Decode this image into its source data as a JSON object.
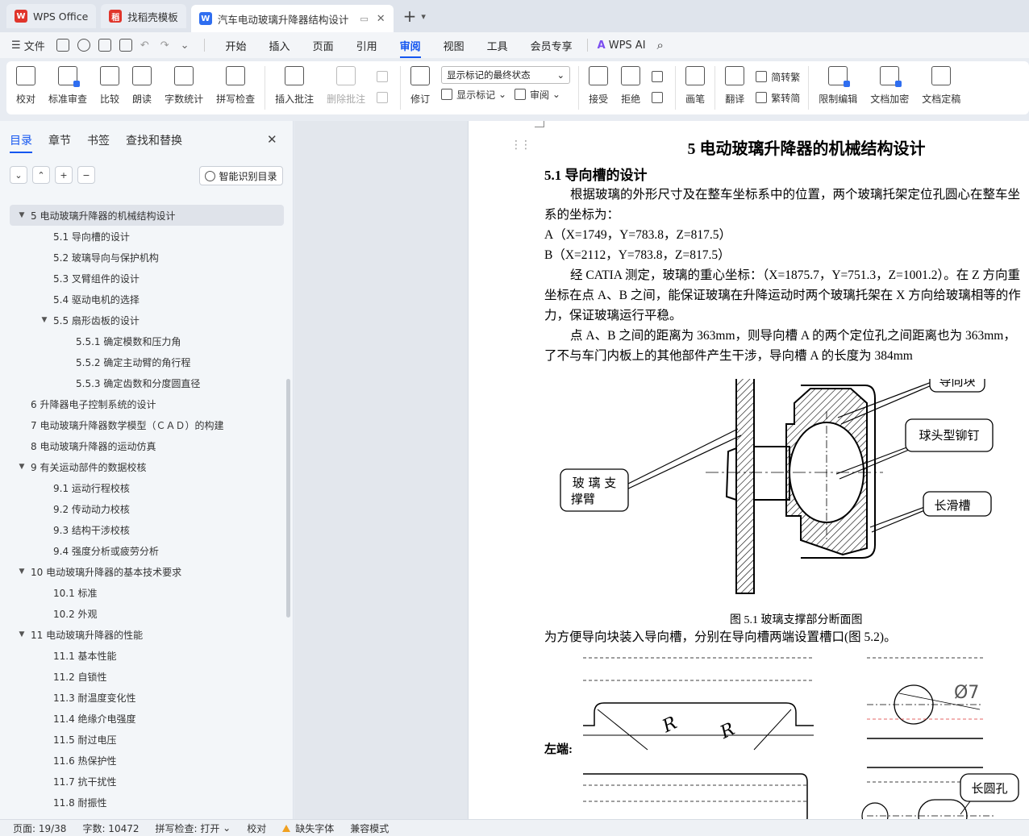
{
  "tabs": [
    {
      "label": "WPS Office",
      "color": "#e0352b"
    },
    {
      "label": "找稻壳模板",
      "color": "#e0352b"
    },
    {
      "label": "汽车电动玻璃升降器结构设计",
      "color": "#2f6ef0"
    }
  ],
  "menubar": {
    "file": "文件",
    "items": [
      "开始",
      "插入",
      "页面",
      "引用",
      "审阅",
      "视图",
      "工具",
      "会员专享"
    ],
    "active": "审阅",
    "wps_ai": "WPS AI"
  },
  "ribbon": {
    "proofread": "校对",
    "standard_review": "标准审查",
    "compare": "比较",
    "read_aloud": "朗读",
    "word_count": "字数统计",
    "spell_check": "拼写检查",
    "insert_comment": "插入批注",
    "delete_comment": "删除批注",
    "revise": "修订",
    "markup_display": "显示标记的最终状态",
    "show_markup": "显示标记",
    "review": "审阅",
    "accept": "接受",
    "reject": "拒绝",
    "pen": "画笔",
    "translate": "翻译",
    "to_traditional": "简转繁",
    "to_simplified": "繁转简",
    "restrict_edit": "限制编辑",
    "doc_encrypt": "文档加密",
    "doc_finalize": "文档定稿"
  },
  "nav": {
    "tabs": [
      "目录",
      "章节",
      "书签",
      "查找和替换"
    ],
    "active_tab": "目录",
    "smart_button": "智能识别目录",
    "toc": [
      {
        "label": "5  电动玻璃升降器的机械结构设计",
        "level": 1,
        "arrow": "▼",
        "selected": true
      },
      {
        "label": "5.1 导向槽的设计",
        "level": 2,
        "arrow": ""
      },
      {
        "label": "5.2  玻璃导向与保护机构",
        "level": 2,
        "arrow": ""
      },
      {
        "label": "5.3  叉臂组件的设计",
        "level": 2,
        "arrow": ""
      },
      {
        "label": "5.4    驱动电机的选择",
        "level": 2,
        "arrow": ""
      },
      {
        "label": "5.5  扇形齿板的设计",
        "level": 2,
        "arrow": "▼"
      },
      {
        "label": "5.5.1  确定模数和压力角",
        "level": 3,
        "arrow": ""
      },
      {
        "label": "5.5.2  确定主动臂的角行程",
        "level": 3,
        "arrow": ""
      },
      {
        "label": "5.5.3  确定齿数和分度圆直径",
        "level": 3,
        "arrow": ""
      },
      {
        "label": "6  升降器电子控制系统的设计",
        "level": 1,
        "arrow": ""
      },
      {
        "label": "7  电动玻璃升降器数学模型（ＣＡＤ）的构建",
        "level": 1,
        "arrow": ""
      },
      {
        "label": "8  电动玻璃升降器的运动仿真",
        "level": 1,
        "arrow": ""
      },
      {
        "label": "9 有关运动部件的数据校核",
        "level": 1,
        "arrow": "▼"
      },
      {
        "label": "9.1 运动行程校核",
        "level": 2,
        "arrow": ""
      },
      {
        "label": "9.2 传动动力校核",
        "level": 2,
        "arrow": ""
      },
      {
        "label": "9.3 结构干涉校核",
        "level": 2,
        "arrow": ""
      },
      {
        "label": "9.4 强度分析或疲劳分析",
        "level": 2,
        "arrow": ""
      },
      {
        "label": "10  电动玻璃升降器的基本技术要求",
        "level": 1,
        "arrow": "▼"
      },
      {
        "label": "10.1    标准",
        "level": 2,
        "arrow": ""
      },
      {
        "label": "10.2    外观",
        "level": 2,
        "arrow": ""
      },
      {
        "label": "11  电动玻璃升降器的性能",
        "level": 1,
        "arrow": "▼"
      },
      {
        "label": "11.1    基本性能",
        "level": 2,
        "arrow": ""
      },
      {
        "label": "11.2    自锁性",
        "level": 2,
        "arrow": ""
      },
      {
        "label": "11.3    耐温度变化性",
        "level": 2,
        "arrow": ""
      },
      {
        "label": "11.4    绝缘介电强度",
        "level": 2,
        "arrow": ""
      },
      {
        "label": "11.5    耐过电压",
        "level": 2,
        "arrow": ""
      },
      {
        "label": "11.6    热保护性",
        "level": 2,
        "arrow": ""
      },
      {
        "label": "11.7    抗干扰性",
        "level": 2,
        "arrow": ""
      },
      {
        "label": "11.8    耐振性",
        "level": 2,
        "arrow": ""
      }
    ]
  },
  "document": {
    "chapter_title": "5  电动玻璃升降器的机械结构设计",
    "section_title": "5.1 导向槽的设计",
    "p1_line1": "根据玻璃的外形尺寸及在整车坐标系中的位置，两个玻璃托架定位孔圆心在整车坐",
    "p1_line2": "系的坐标为：",
    "coord_a": "A（X=1749，Y=783.8，Z=817.5）",
    "coord_b": "B（X=2112，Y=783.8，Z=817.5）",
    "p2_line1": "经 CATIA 测定，玻璃的重心坐标：（X=1875.7，Y=751.3，Z=1001.2）。在 Z 方向重",
    "p2_line2": "坐标在点 A、B 之间，能保证玻璃在升降运动时两个玻璃托架在 X 方向给玻璃相等的作",
    "p2_line3": "力，保证玻璃运行平稳。",
    "p3_line1": "点 A、B 之间的距离为 363mm，则导向槽 A 的两个定位孔之间距离也为 363mm，",
    "p3_line2": "了不与车门内板上的其他部件产生干涉，导向槽 A 的长度为 384mm",
    "fig1_labels": {
      "guide_block": "导向块",
      "ball_rivet": "球头型铆钉",
      "glass_arm_1": "玻 璃 支",
      "glass_arm_2": "撑臂",
      "long_slot": "长滑槽"
    },
    "fig1_caption": "图 5.1 玻璃支撑部分断面图",
    "p4": "为方便导向块装入导向槽，分别在导向槽两端设置槽口(图 5.2)。",
    "fig2_left_end": "左端:",
    "fig2_diameter": "Ø7",
    "fig2_long_hole": "长圆孔"
  },
  "statusbar": {
    "page": "页面: 19/38",
    "words": "字数: 10472",
    "spell": "拼写检查: 打开",
    "proof": "校对",
    "missing_font": "缺失字体",
    "compat": "兼容模式"
  }
}
